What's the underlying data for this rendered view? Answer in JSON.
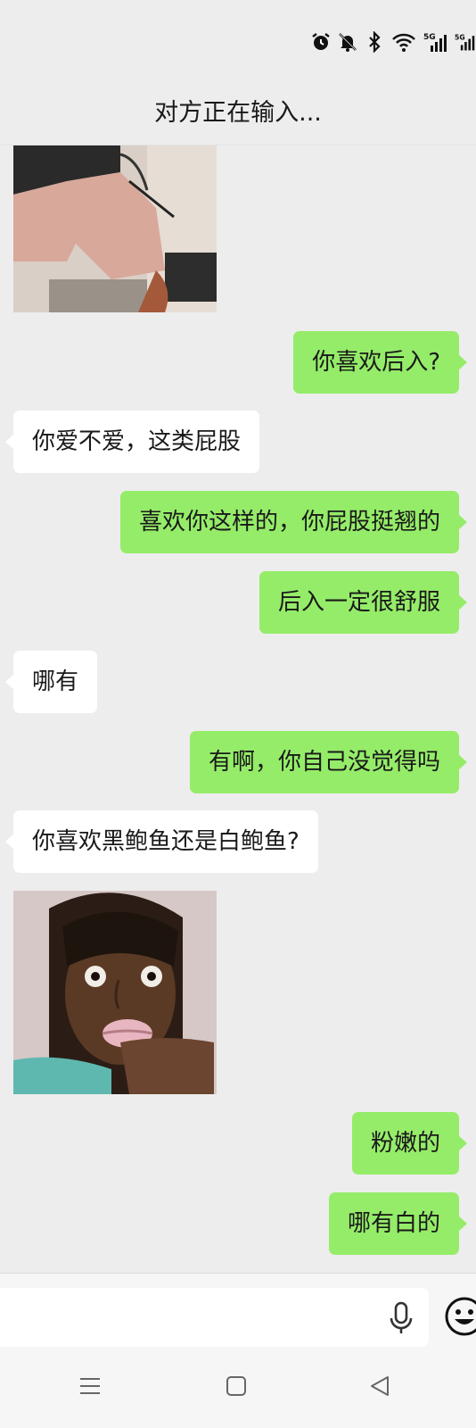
{
  "header": {
    "title": "对方正在输入..."
  },
  "status_bar": {
    "icons": [
      "alarm-icon",
      "muted-bell-icon",
      "bluetooth-icon",
      "wifi-icon",
      "signal-5g-icon",
      "signal-5g-icon"
    ],
    "network_label": "5G"
  },
  "messages": [
    {
      "kind": "image",
      "side": "left",
      "content": "photo-image"
    },
    {
      "kind": "text",
      "side": "right",
      "text": "你喜欢后入?"
    },
    {
      "kind": "text",
      "side": "left",
      "text": "你爱不爱，这类屁股"
    },
    {
      "kind": "text",
      "side": "right",
      "text": "喜欢你这样的，你屁股挺翘的"
    },
    {
      "kind": "text",
      "side": "right",
      "text": "后入一定很舒服"
    },
    {
      "kind": "text",
      "side": "left",
      "text": "哪有"
    },
    {
      "kind": "text",
      "side": "right",
      "text": "有啊，你自己没觉得吗"
    },
    {
      "kind": "text",
      "side": "left",
      "text": "你喜欢黑鲍鱼还是白鲍鱼?"
    },
    {
      "kind": "image",
      "side": "left",
      "content": "meme-face-image"
    },
    {
      "kind": "text",
      "side": "right",
      "text": "粉嫩的"
    },
    {
      "kind": "text",
      "side": "right",
      "text": "哪有白的"
    }
  ],
  "input_bar": {
    "value": "",
    "placeholder": "",
    "mic": "mic-icon",
    "emoji": "emoji-icon"
  },
  "nav_bar": {
    "items": [
      "menu-icon",
      "home-square-icon",
      "back-triangle-icon"
    ]
  },
  "colors": {
    "background": "#ededed",
    "outgoing_bubble": "#95ec69",
    "incoming_bubble": "#ffffff"
  }
}
